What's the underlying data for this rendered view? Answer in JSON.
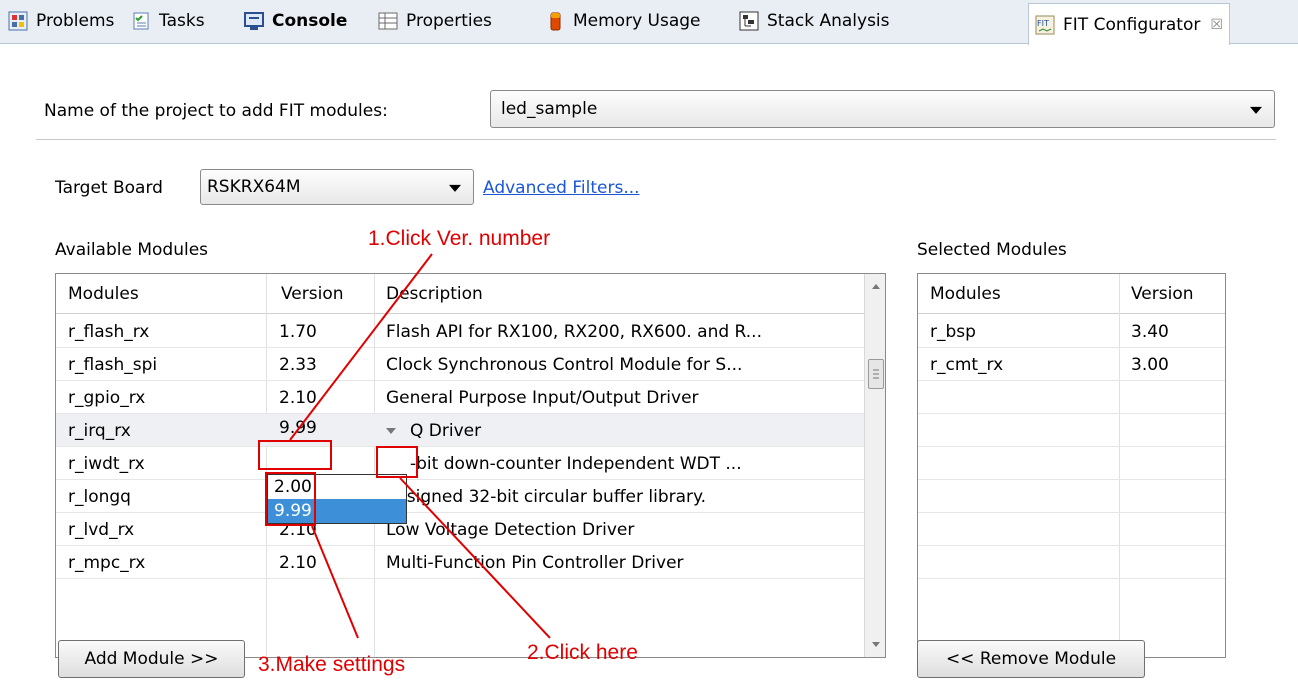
{
  "tabs": [
    {
      "label": "Problems",
      "icon": "problems-icon"
    },
    {
      "label": "Tasks",
      "icon": "tasks-icon"
    },
    {
      "label": "Console",
      "icon": "console-icon"
    },
    {
      "label": "Properties",
      "icon": "properties-icon"
    },
    {
      "label": "Memory Usage",
      "icon": "memory-usage-icon"
    },
    {
      "label": "Stack Analysis",
      "icon": "stack-analysis-icon"
    },
    {
      "label": "FIT Configurator",
      "icon": "fit-configurator-icon"
    }
  ],
  "tab_close": "☒",
  "project": {
    "label": "Name of the project to add FIT modules:",
    "value": "led_sample"
  },
  "target_board": {
    "label": "Target Board",
    "value": "RSKRX64M"
  },
  "advanced_filters": "Advanced Filters...",
  "available": {
    "title": "Available Modules",
    "headers": [
      "Modules",
      "Version",
      "Description"
    ],
    "rows": [
      {
        "module": "r_flash_rx",
        "version": "1.70",
        "description": "Flash API for RX100, RX200, RX600. and R..."
      },
      {
        "module": "r_flash_spi",
        "version": "2.33",
        "description": "Clock Synchronous Control Module for S..."
      },
      {
        "module": "r_gpio_rx",
        "version": "2.10",
        "description": "General Purpose Input/Output Driver"
      },
      {
        "module": "r_irq_rx",
        "version": "9.99",
        "description": "Q Driver"
      },
      {
        "module": "r_iwdt_rx",
        "version": "",
        "description": "-bit down-counter Independent WDT ..."
      },
      {
        "module": "r_longq",
        "version": "",
        "description": "nsigned 32-bit circular buffer library."
      },
      {
        "module": "r_lvd_rx",
        "version": "2.10",
        "description": "Low Voltage Detection Driver"
      },
      {
        "module": "r_mpc_rx",
        "version": "2.10",
        "description": "Multi-Function Pin Controller Driver"
      }
    ],
    "version_options": [
      "2.00",
      "9.99"
    ],
    "selected_option": "9.99"
  },
  "selected": {
    "title": "Selected Modules",
    "headers": [
      "Modules",
      "Version"
    ],
    "rows": [
      {
        "module": "r_bsp",
        "version": "3.40"
      },
      {
        "module": "r_cmt_rx",
        "version": "3.00"
      }
    ]
  },
  "buttons": {
    "add": "Add Module >>",
    "remove": "<< Remove Module"
  },
  "annotations": {
    "step1": "1.Click Ver. number",
    "step2": "2.Click here",
    "step3": "3.Make settings",
    "color": "#e00000"
  }
}
